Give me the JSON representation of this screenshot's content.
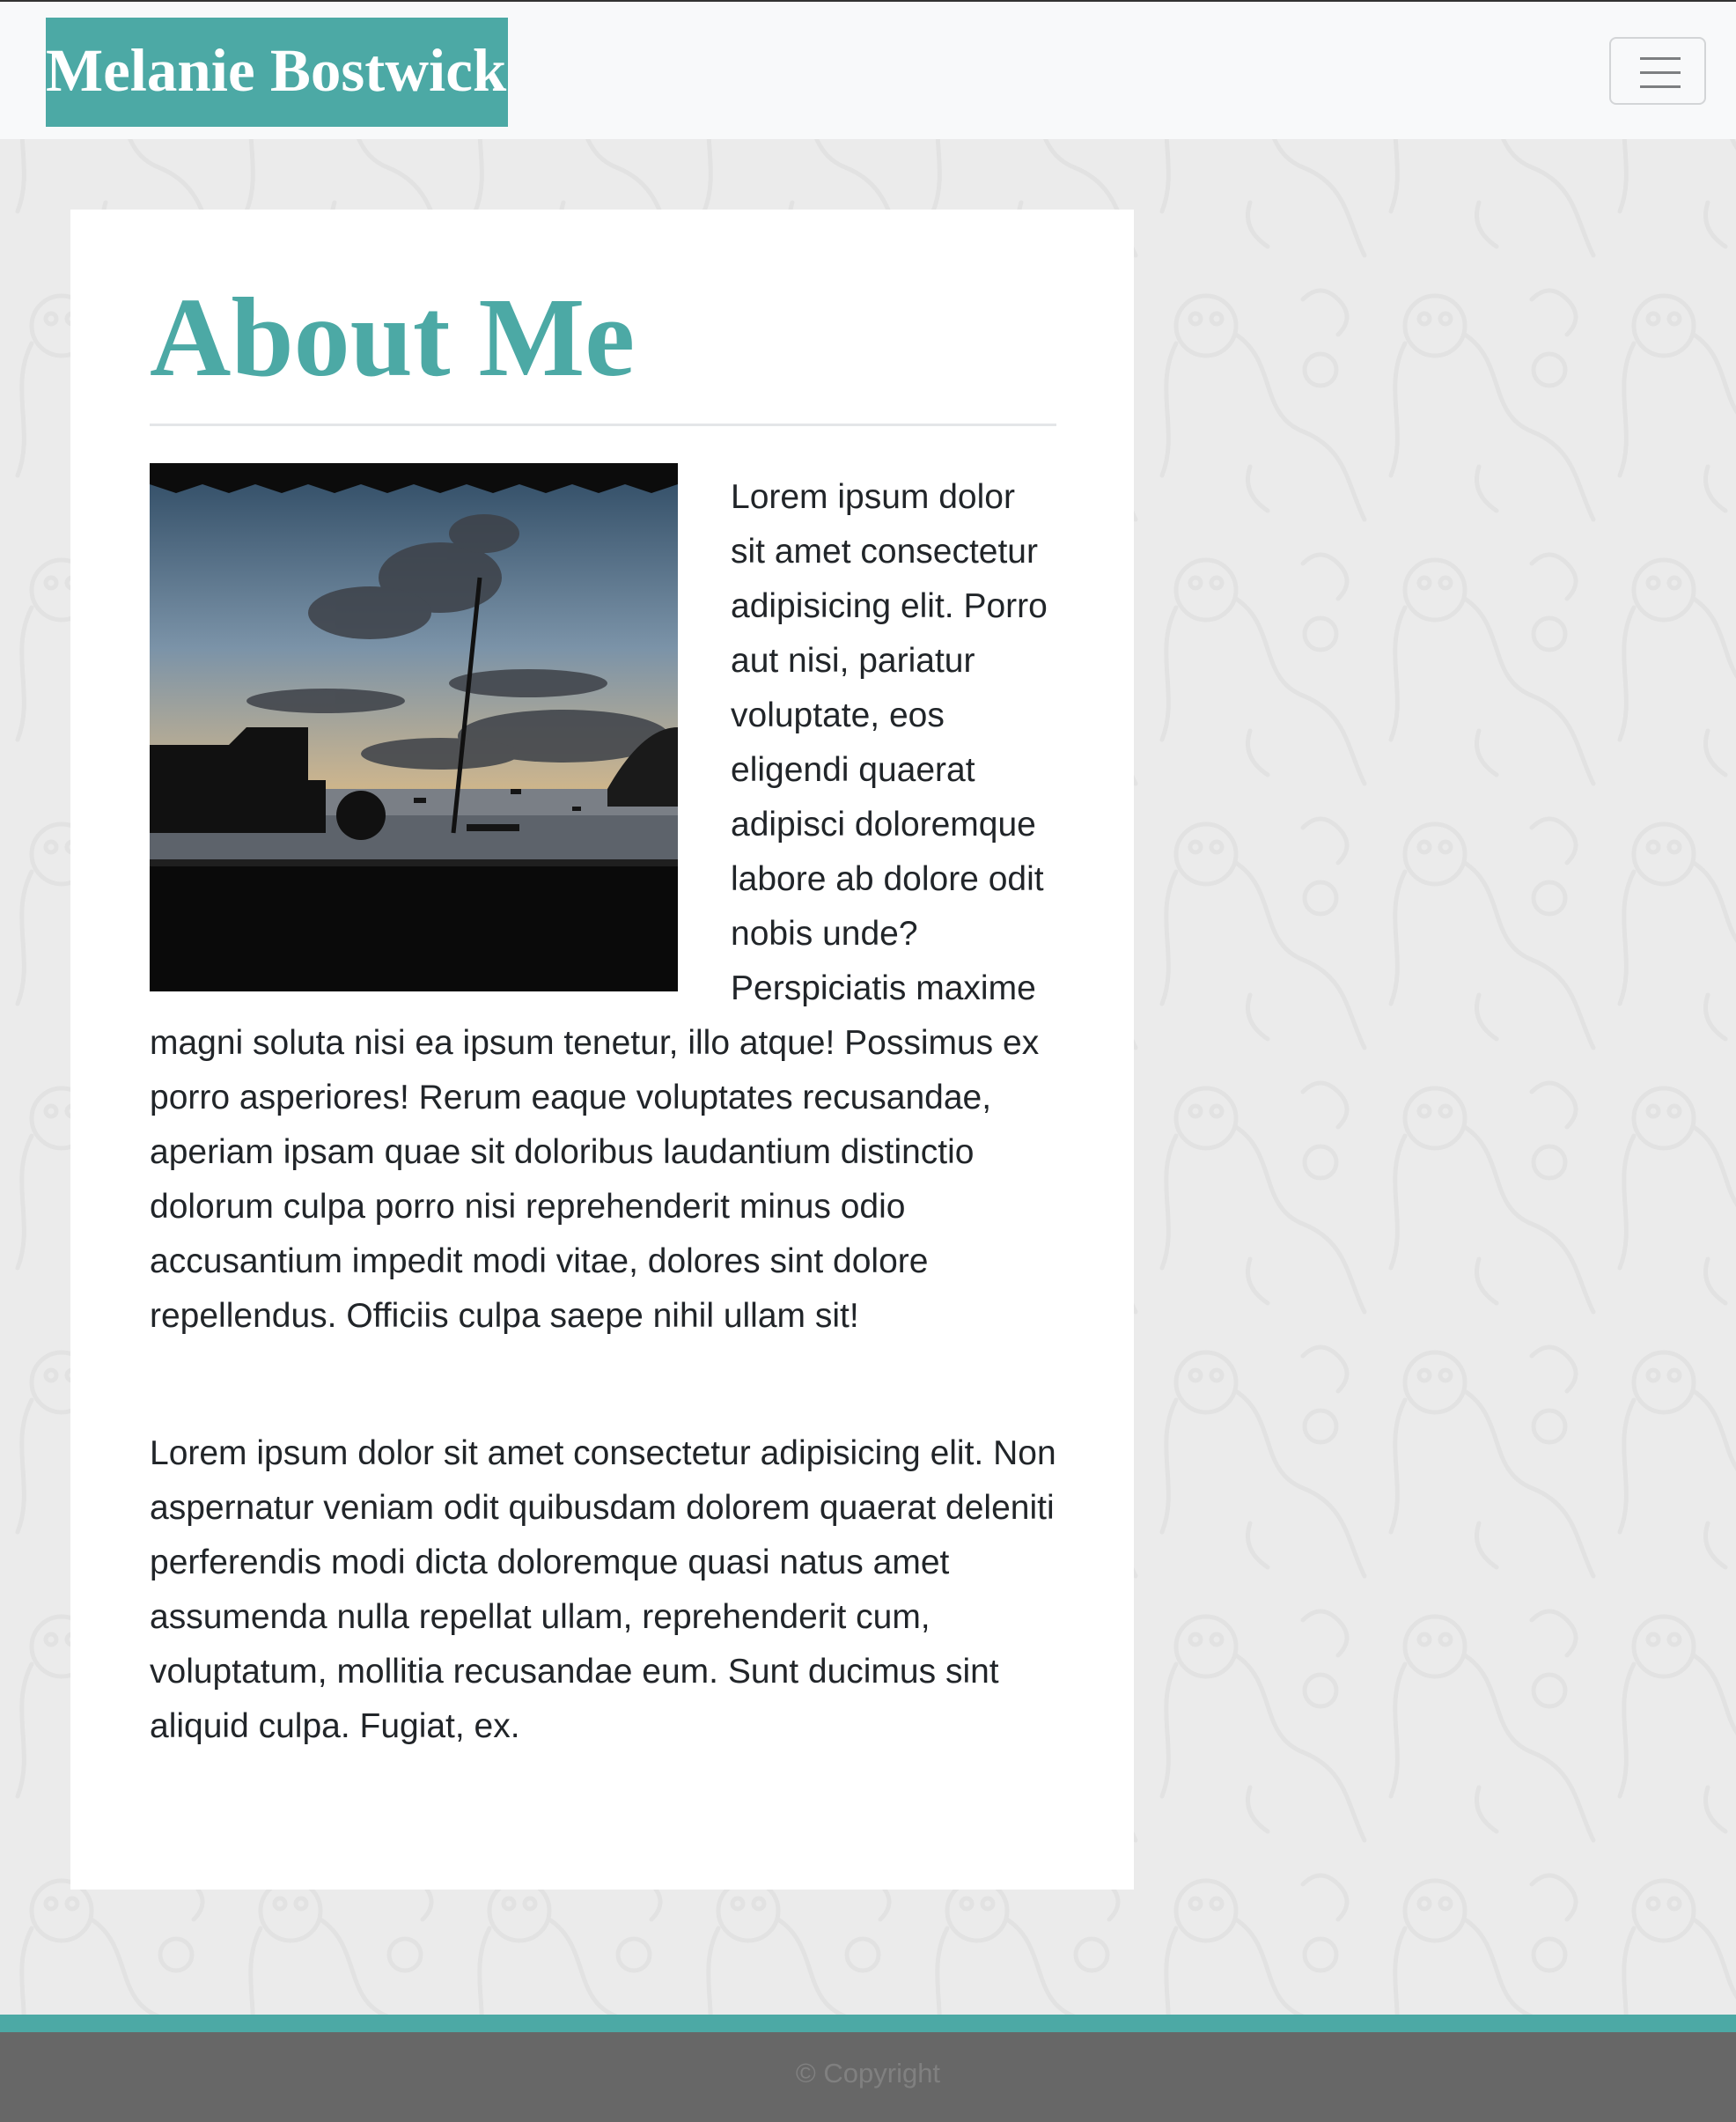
{
  "navbar": {
    "brand": "Melanie Bostwick",
    "toggle_icon": "hamburger-menu-icon"
  },
  "main": {
    "title": "About Me",
    "photo_icon": "sunset-harbor-photo",
    "paragraph_1": "Lorem ipsum dolor sit amet consectetur adipisicing elit. Porro aut nisi, pariatur voluptate, eos eligendi quaerat adipisci doloremque labore ab dolore odit nobis unde? Perspiciatis maxime magni soluta nisi ea ipsum tenetur, illo atque! Possimus ex porro asperiores! Rerum eaque voluptates recusandae, aperiam ipsam quae sit doloribus laudantium distinctio dolorum culpa porro nisi reprehenderit minus odio accusantium impedit modi vitae, dolores sint dolore repellendus. Officiis culpa saepe nihil ullam sit!",
    "paragraph_2": "Lorem ipsum dolor sit amet consectetur adipisicing elit. Non aspernatur veniam odit quibusdam dolorem quaerat deleniti perferendis modi dicta doloremque quasi natus amet assumenda nulla repellat ullam, reprehenderit cum, voluptatum, mollitia recusandae eum. Sunt ducimus sint aliquid culpa. Fugiat, ex."
  },
  "footer": {
    "copyright": "© Copyright"
  },
  "colors": {
    "accent": "#4ca9a5",
    "navbar_bg": "#f8f9fa",
    "page_bg": "#ebebeb",
    "footer_bg": "#676767",
    "text": "#212529"
  }
}
